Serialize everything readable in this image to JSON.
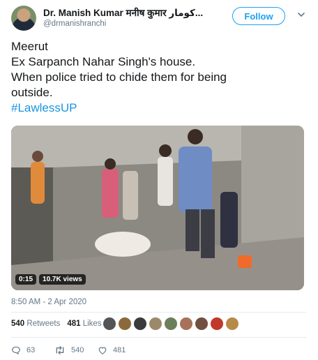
{
  "header": {
    "display_name": "Dr. Manish Kumar मनीष कुमार کومار...",
    "handle": "@drmanishranchi",
    "follow_label": "Follow"
  },
  "tweet": {
    "lines": [
      "Meerut",
      "Ex Sarpanch Nahar Singh's house.",
      "When police tried to chide them for being",
      "outside."
    ],
    "hashtag": "#LawlessUP"
  },
  "video": {
    "duration": "0:15",
    "views": "10.7K views"
  },
  "timestamp": "8:50 AM - 2 Apr 2020",
  "stats": {
    "retweets_count": "540",
    "retweets_label": "Retweets",
    "likes_count": "481",
    "likes_label": "Likes"
  },
  "actions": {
    "reply_count": "63",
    "retweet_count": "540",
    "like_count": "481"
  },
  "icons": [
    "chevron-down-icon",
    "reply-icon",
    "retweet-icon",
    "heart-icon"
  ],
  "colors": {
    "accent": "#1da1f2",
    "text": "#14171a",
    "muted": "#657786"
  }
}
